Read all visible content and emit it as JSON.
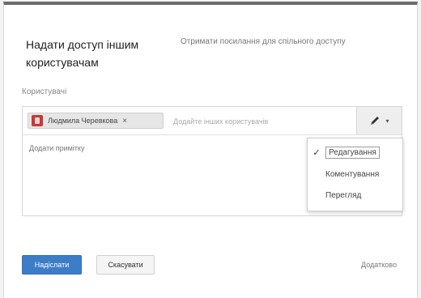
{
  "dialog": {
    "title": "Надати доступ іншим користувачам",
    "share_link_text": "Отримати посилання для спільного доступу"
  },
  "people": {
    "label": "Користувачі",
    "chip_name": "Людмила Черевкова",
    "chip_remove": "×",
    "input_placeholder": "Додайте інших користувачів",
    "note_placeholder": "Додати примітку"
  },
  "permission": {
    "caret": "▾",
    "options": [
      {
        "label": "Редагування",
        "selected": true
      },
      {
        "label": "Коментування",
        "selected": false
      },
      {
        "label": "Перегляд",
        "selected": false
      }
    ],
    "check_glyph": "✓"
  },
  "footer": {
    "send_label": "Надіслати",
    "cancel_label": "Скасувати",
    "done_label": "Додатково"
  },
  "colors": {
    "accent": "#3d7dc7",
    "avatar": "#c23a3a"
  }
}
